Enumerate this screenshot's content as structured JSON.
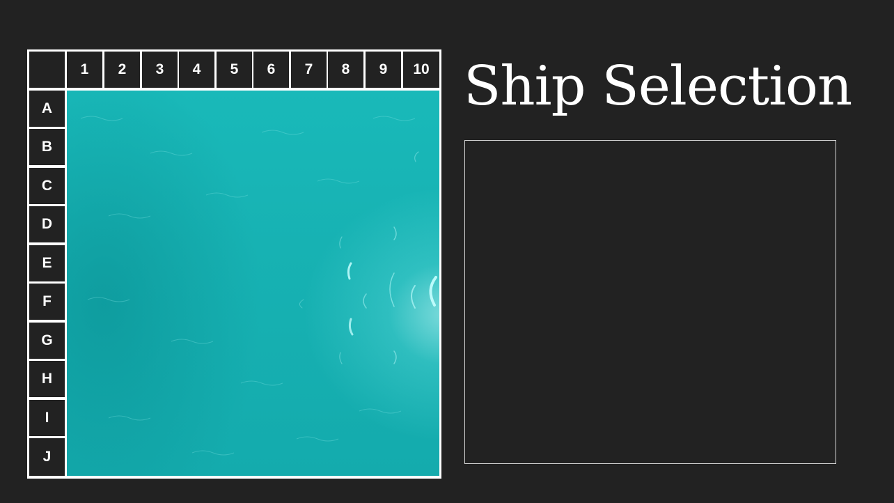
{
  "title": "Ship Selection",
  "board": {
    "columns": [
      "1",
      "2",
      "3",
      "4",
      "5",
      "6",
      "7",
      "8",
      "9",
      "10"
    ],
    "rows": [
      "A",
      "B",
      "C",
      "D",
      "E",
      "F",
      "G",
      "H",
      "I",
      "J"
    ]
  },
  "colors": {
    "background": "#222222",
    "grid_lines": "#ffffff",
    "ocean": "#17b2b3",
    "text": "#ffffff"
  }
}
